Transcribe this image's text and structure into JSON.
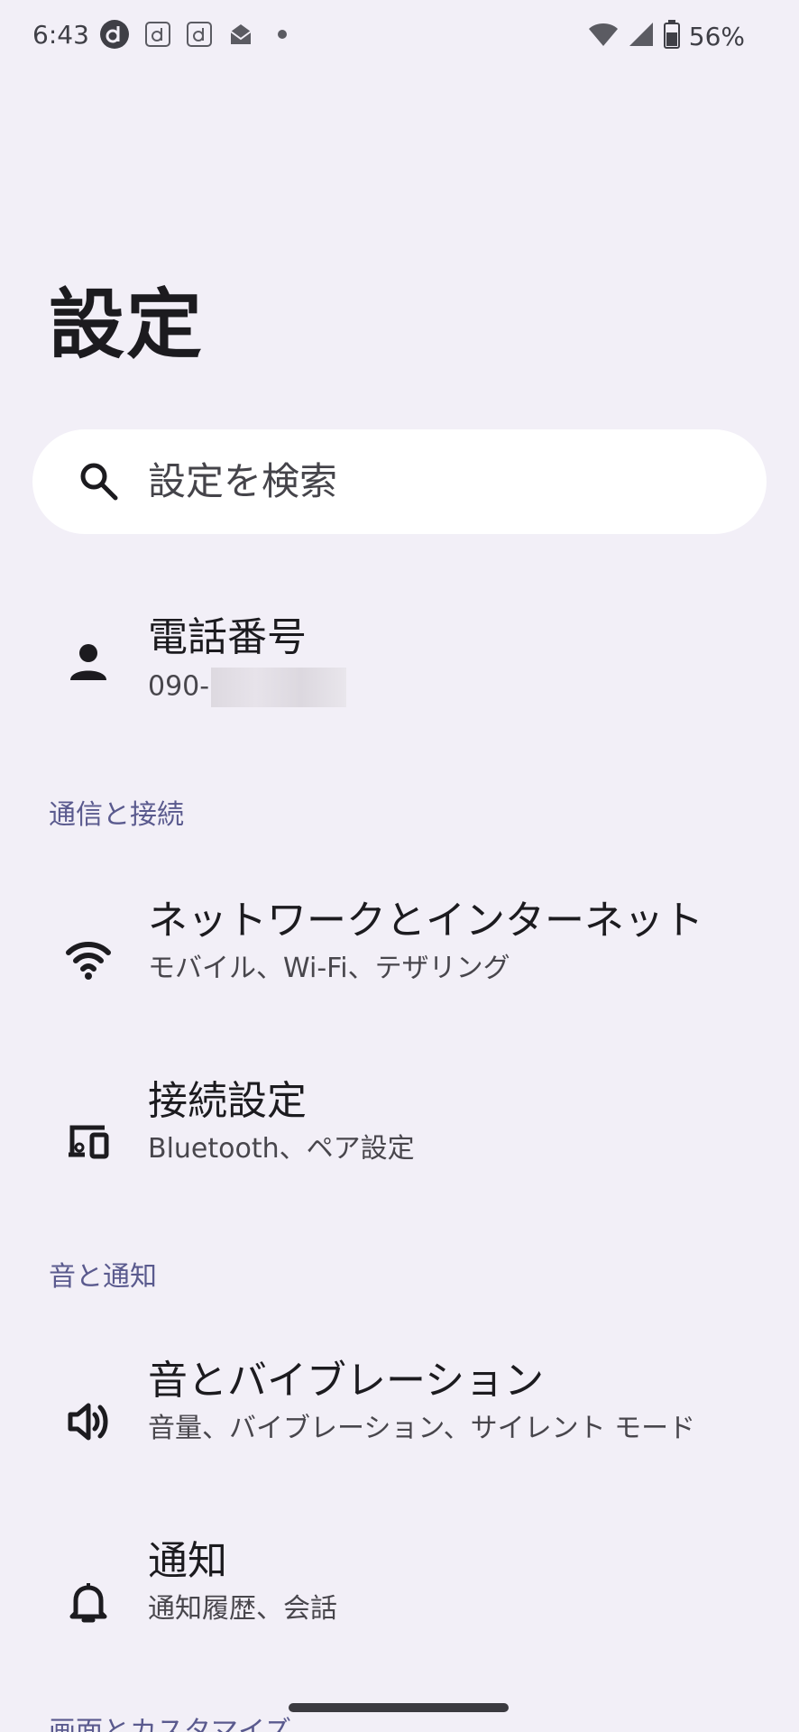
{
  "status_bar": {
    "time": "6:43",
    "notification_icons": [
      "d-menu-icon",
      "docomo-d-icon",
      "docomo-d-icon",
      "mail-icon",
      "dot-icon"
    ],
    "battery_percent": "56%"
  },
  "page_title": "設定",
  "search": {
    "placeholder": "設定を検索"
  },
  "account": {
    "title": "電話番号",
    "phone_prefix": "090-"
  },
  "sections": {
    "connectivity": "通信と接続",
    "sound": "音と通知",
    "display_cutoff": "画面とカスタマイズ"
  },
  "items": {
    "network": {
      "title": "ネットワークとインターネット",
      "subtitle": "モバイル、Wi-Fi、テザリング"
    },
    "connected_devices": {
      "title": "接続設定",
      "subtitle": "Bluetooth、ペア設定"
    },
    "sound": {
      "title": "音とバイブレーション",
      "subtitle": "音量、バイブレーション、サイレント モード"
    },
    "notifications": {
      "title": "通知",
      "subtitle": "通知履歴、会話"
    }
  },
  "colors": {
    "background": "#f2eff7",
    "section_header": "#5a5a8e",
    "search_bg": "#ffffff"
  }
}
